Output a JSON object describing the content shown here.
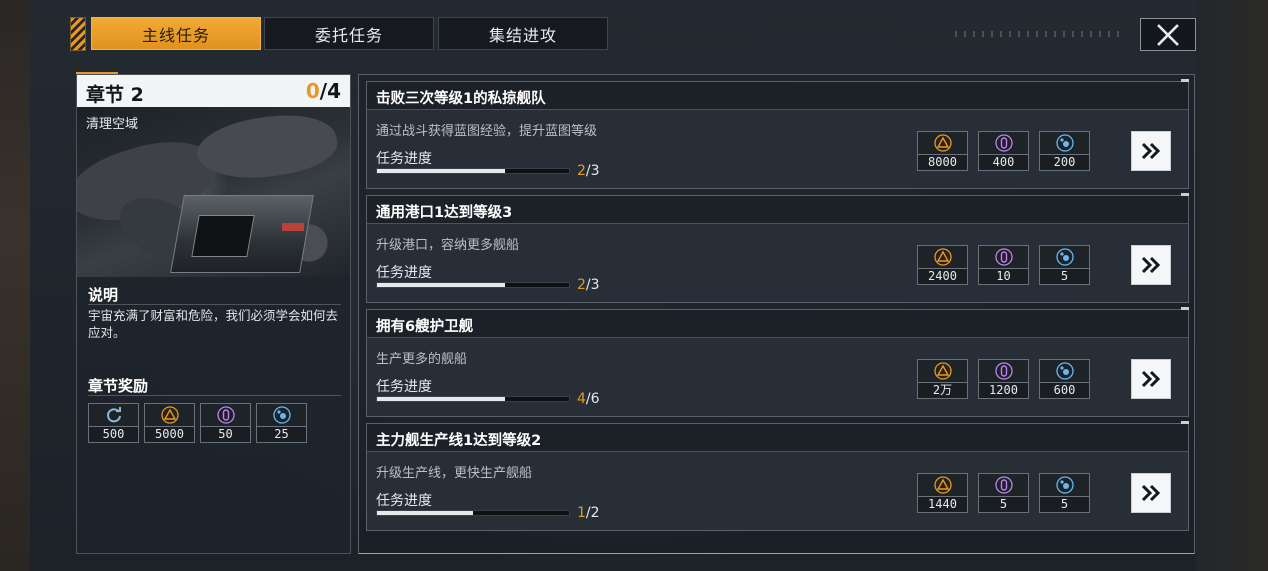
{
  "tabs": [
    {
      "label": "主线任务",
      "active": true
    },
    {
      "label": "委托任务",
      "active": false
    },
    {
      "label": "集结进攻",
      "active": false
    }
  ],
  "chapter": {
    "title": "章节 2",
    "progress_current": "0",
    "progress_total": "/4",
    "subtitle": "清理空域",
    "desc_heading": "说明",
    "desc_text": "宇宙充满了财富和危险，我们必须学会如何去应对。",
    "rewards_heading": "章节奖励",
    "rewards": [
      {
        "icon": "refresh-icon",
        "value": "500"
      },
      {
        "icon": "triangle-resource-icon",
        "value": "5000"
      },
      {
        "icon": "crystal-resource-icon",
        "value": "50"
      },
      {
        "icon": "gas-resource-icon",
        "value": "25"
      }
    ]
  },
  "tasks": [
    {
      "title": "击败三次等级1的私掠舰队",
      "desc": "通过战斗获得蓝图经验，提升蓝图等级",
      "progress_label": "任务进度",
      "current": "2",
      "total": "/3",
      "progress": 0.667,
      "rewards": [
        {
          "icon": "triangle-resource-icon",
          "value": "8000"
        },
        {
          "icon": "crystal-resource-icon",
          "value": "400"
        },
        {
          "icon": "gas-resource-icon",
          "value": "200"
        }
      ]
    },
    {
      "title": "通用港口1达到等级3",
      "desc": "升级港口，容纳更多舰船",
      "progress_label": "任务进度",
      "current": "2",
      "total": "/3",
      "progress": 0.667,
      "rewards": [
        {
          "icon": "triangle-resource-icon",
          "value": "2400"
        },
        {
          "icon": "crystal-resource-icon",
          "value": "10"
        },
        {
          "icon": "gas-resource-icon",
          "value": "5"
        }
      ]
    },
    {
      "title": "拥有6艘护卫舰",
      "desc": "生产更多的舰船",
      "progress_label": "任务进度",
      "current": "4",
      "total": "/6",
      "progress": 0.667,
      "rewards": [
        {
          "icon": "triangle-resource-icon",
          "value": "2万"
        },
        {
          "icon": "crystal-resource-icon",
          "value": "1200"
        },
        {
          "icon": "gas-resource-icon",
          "value": "600"
        }
      ]
    },
    {
      "title": "主力舰生产线1达到等级2",
      "desc": "升级生产线，更快生产舰船",
      "progress_label": "任务进度",
      "current": "1",
      "total": "/2",
      "progress": 0.5,
      "rewards": [
        {
          "icon": "triangle-resource-icon",
          "value": "1440"
        },
        {
          "icon": "crystal-resource-icon",
          "value": "5"
        },
        {
          "icon": "gas-resource-icon",
          "value": "5"
        }
      ]
    }
  ],
  "colors": {
    "accent": "#e39a2a",
    "triangle": "#e39a2a",
    "crystal": "#b58ae8",
    "gas": "#6fb6e8",
    "refresh": "#8fb8d8"
  }
}
